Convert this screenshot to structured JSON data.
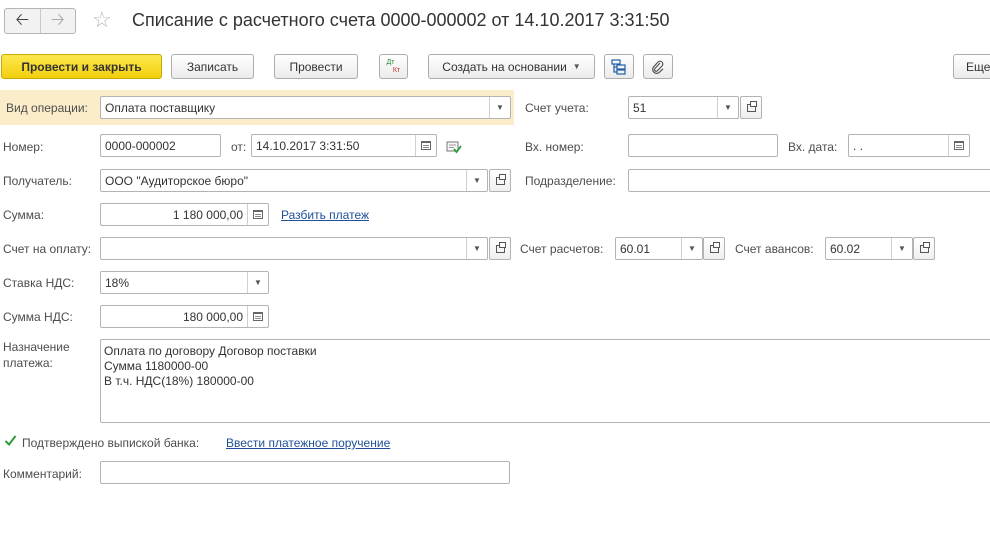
{
  "header": {
    "title": "Списание с расчетного счета 0000-000002 от 14.10.2017 3:31:50",
    "back_icon": "arrow-left-icon",
    "forward_icon": "arrow-right-icon",
    "favorite_icon": "star-icon"
  },
  "toolbar": {
    "post_close": "Провести и закрыть",
    "save": "Записать",
    "post": "Провести",
    "dt_label": "Дт",
    "kt_label": "Кт",
    "create_based": "Создать на основании",
    "more": "Еще"
  },
  "form": {
    "operation_label": "Вид операции:",
    "operation_value": "Оплата поставщику",
    "account_label": "Счет учета:",
    "account_value": "51",
    "number_label": "Номер:",
    "number_value": "0000-000002",
    "date_label": "от:",
    "date_value": "14.10.2017  3:31:50",
    "in_number_label": "Вх. номер:",
    "in_number_value": "",
    "in_date_label": "Вх. дата:",
    "in_date_value": " .  .",
    "recipient_label": "Получатель:",
    "recipient_value": "ООО \"Аудиторское бюро\"",
    "division_label": "Подразделение:",
    "division_value": "",
    "sum_label": "Сумма:",
    "sum_value": "1 180 000,00",
    "split_link": "Разбить платеж",
    "invoice_label": "Счет на оплату:",
    "invoice_value": "",
    "settle_label": "Счет расчетов:",
    "settle_value": "60.01",
    "advance_label": "Счет авансов:",
    "advance_value": "60.02",
    "vat_rate_label": "Ставка НДС:",
    "vat_rate_value": "18%",
    "vat_sum_label": "Сумма НДС:",
    "vat_sum_value": "180 000,00",
    "purpose_label_1": "Назначение",
    "purpose_label_2": "платежа:",
    "purpose_lines": [
      "Оплата по договору Договор поставки",
      "Сумма 1180000-00",
      "В т.ч. НДС(18%) 180000-00"
    ],
    "confirmed_label": "Подтверждено выпиской банка:",
    "confirmed_checked": true,
    "payment_order_link": "Ввести платежное поручение",
    "comment_label": "Комментарий:",
    "comment_value": ""
  },
  "colors": {
    "primary_button": "#f2cf0d",
    "highlight": "#fbedca",
    "link": "#1f4e9a"
  }
}
